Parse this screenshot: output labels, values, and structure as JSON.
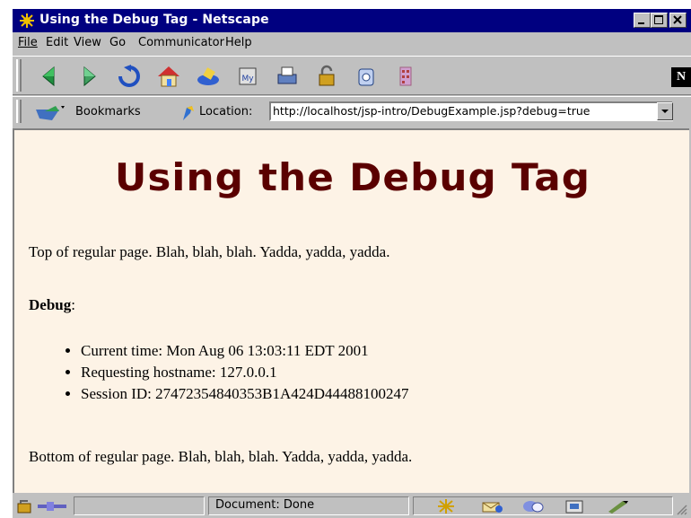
{
  "window": {
    "title": "Using the Debug Tag - Netscape"
  },
  "menu": [
    "File",
    "Edit",
    "View",
    "Go",
    "Communicator",
    "Help"
  ],
  "toolbar": {
    "buttons": [
      "back-icon",
      "forward-icon",
      "reload-icon",
      "home-icon",
      "search-icon",
      "my-netscape-icon",
      "print-icon",
      "security-icon",
      "shop-icon",
      "stop-icon"
    ],
    "brand": "N"
  },
  "location_bar": {
    "bookmarks_label": "Bookmarks",
    "location_label": "Location:",
    "url": "http://localhost/jsp-intro/DebugExample.jsp?debug=true"
  },
  "page": {
    "heading": "Using the Debug Tag",
    "top_text": "Top of regular page. Blah, blah, blah. Yadda, yadda, yadda.",
    "debug_label": "Debug",
    "debug_colon": ":",
    "debug_items": [
      "Current time: Mon Aug 06 13:03:11 EDT 2001",
      "Requesting hostname: 127.0.0.1",
      "Session ID: 27472354840353B1A424D44488100247"
    ],
    "bottom_text": "Bottom of regular page. Blah, blah, blah. Yadda, yadda, yadda."
  },
  "status": {
    "text": "Document: Done"
  },
  "colors": {
    "titlebar": "#000080",
    "chrome": "#c0c0c0",
    "page_bg": "#fdf3e6",
    "heading": "#5a0000"
  }
}
